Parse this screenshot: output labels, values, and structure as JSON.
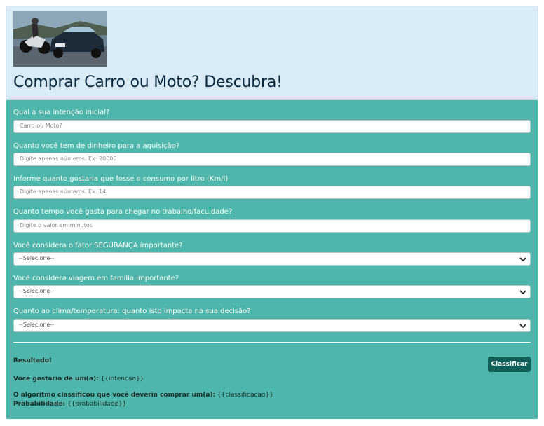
{
  "page": {
    "title": "Comprar Carro ou Moto? Descubra!"
  },
  "fields": [
    {
      "label": "Qual a sua intenção inicial?",
      "placeholder": "Carro ou Moto?"
    },
    {
      "label": "Quanto você tem de dinheiro para a aquisição?",
      "placeholder": "Digite apenas números. Ex: 20000"
    },
    {
      "label": "Informe quanto gostaria que fosse o consumo por litro (Km/l)",
      "placeholder": "Digite apenas números. Ex: 14"
    },
    {
      "label": "Quanto tempo você gasta para chegar no trabalho/faculdade?",
      "placeholder": "Digite o valor em minutos"
    }
  ],
  "selects": [
    {
      "label": "Você considera o fator SEGURANÇA importante?",
      "value": "--Selecione--"
    },
    {
      "label": "Você considera viagem em família importante?",
      "value": "--Selecione--"
    },
    {
      "label": "Quanto ao clima/temperatura: quanto isto impacta na sua decisão?",
      "value": "--Selecione--"
    }
  ],
  "button": {
    "label": "Classificar"
  },
  "result": {
    "heading": "Resultado!",
    "intencao_label": "Você gostaria de um(a):",
    "intencao_value": "{{intencao}}",
    "classificacao_label": "O algoritmo classificou que você deveria comprar um(a):",
    "classificacao_value": "{{classificacao}}",
    "probabilidade_label": "Probabilidade:",
    "probabilidade_value": "{{probabilidade}}"
  }
}
